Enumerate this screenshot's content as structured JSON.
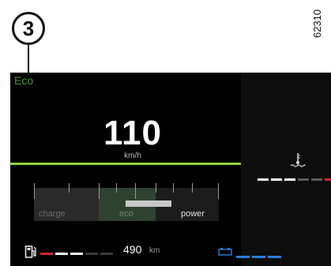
{
  "callout": {
    "number": "3"
  },
  "figure_code": "62310",
  "cluster": {
    "mode": "Eco",
    "speed": {
      "value": "110",
      "unit": "km/h"
    },
    "power_gauge": {
      "labels": [
        "charge",
        "eco",
        "power"
      ],
      "active": "power"
    },
    "range": {
      "value": "490",
      "unit": "km"
    },
    "fuel_level_segments": {
      "filled": 2,
      "total": 5,
      "colors": [
        "#d9232a",
        "#ffffff",
        "#ffffff",
        "#3a3a3a",
        "#3a3a3a"
      ]
    },
    "battery_segments": {
      "filled": 3,
      "total": 3,
      "color": "#2a7de1"
    },
    "coolant_temp_segments": {
      "colors": [
        "#ffffff",
        "#ffffff",
        "#ffffff",
        "#5a5a5a",
        "#5a5a5a",
        "#d9232a"
      ]
    },
    "icons": [
      "fuel-pump-icon",
      "battery-icon",
      "coolant-temperature-icon"
    ],
    "accent_colors": {
      "green_line": "#86d33c",
      "mode_text": "#4a9a3c"
    }
  }
}
